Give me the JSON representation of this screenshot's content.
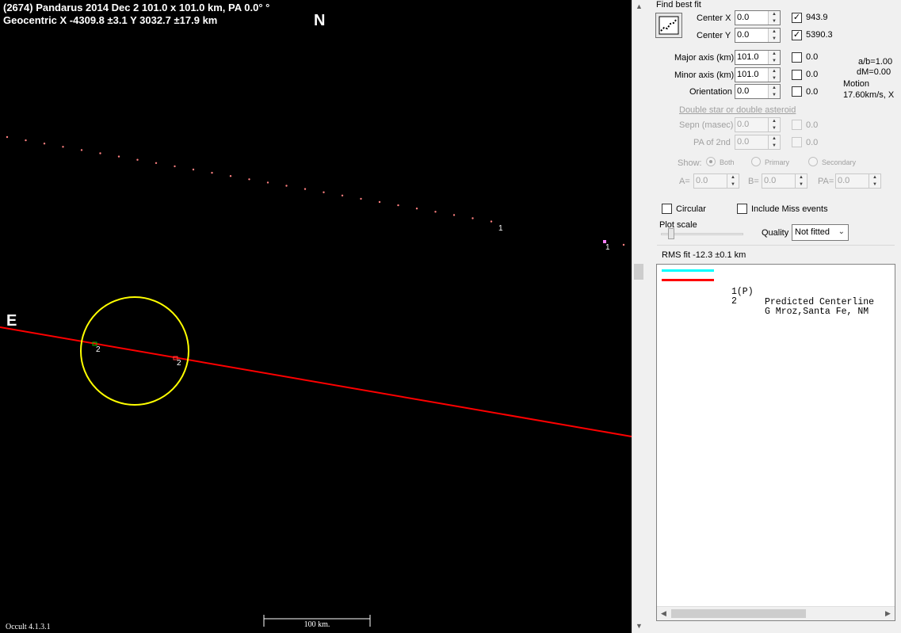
{
  "plot": {
    "title_line1": "(2674) Pandarus  2014 Dec 2  101.0 x 101.0 km, PA 0.0° °",
    "title_line2": "Geocentric  X  -4309.8 ±3.1  Y 3032.7 ±17.9 km",
    "north_label": "N",
    "east_label": "E",
    "version": "Occult 4.1.3.1",
    "scale_label": "100 km.",
    "markers": [
      {
        "label": "1"
      },
      {
        "label": "1"
      },
      {
        "label": "2"
      },
      {
        "label": "2"
      }
    ],
    "colors": {
      "background": "#000000",
      "ellipse": "#ffff00",
      "chord": "#ff0000",
      "predicted": "#00ffff",
      "dots": "#ff8080"
    }
  },
  "panel": {
    "find_best_fit": "Find best fit",
    "center_x": {
      "label": "Center X",
      "value": "0.0",
      "fit_value": "943.9",
      "checked": true
    },
    "center_y": {
      "label": "Center Y",
      "value": "0.0",
      "fit_value": "5390.3",
      "checked": true
    },
    "major_axis": {
      "label": "Major axis (km)",
      "value": "101.0",
      "fit_value": "0.0",
      "checked": false
    },
    "minor_axis": {
      "label": "Minor axis (km)",
      "value": "101.0",
      "fit_value": "0.0",
      "checked": false
    },
    "orientation": {
      "label": "Orientation",
      "value": "0.0",
      "fit_value": "0.0",
      "checked": false
    },
    "ab_ratio": "a/b=1.00",
    "dm": "dM=0.00",
    "motion_label": "Motion",
    "motion_value": "17.60km/s, X",
    "double_star_link": "Double star  or  double asteroid",
    "sepn": {
      "label": "Sepn (masec)",
      "value": "0.0",
      "fit_value": "0.0"
    },
    "pa_2nd": {
      "label": "PA of 2nd",
      "value": "0.0",
      "fit_value": "0.0"
    },
    "show_label": "Show:",
    "show_options": [
      "Both",
      "Primary",
      "Secondary"
    ],
    "a_field": {
      "label": "A=",
      "value": "0.0"
    },
    "b_field": {
      "label": "B=",
      "value": "0.0"
    },
    "pa_field": {
      "label": "PA=",
      "value": "0.0"
    },
    "circular_label": "Circular",
    "include_miss_label": "Include Miss events",
    "plot_scale_label": "Plot scale",
    "quality_label": "Quality",
    "quality_value": "Not fitted",
    "rms_fit": "RMS fit -12.3 ±0.1 km",
    "legend": [
      {
        "num": "1(P)",
        "name": "Predicted Centerline",
        "color": "#00ffff"
      },
      {
        "num": "2",
        "name": "G Mroz,Santa Fe, NM",
        "color": "#ff0000"
      }
    ]
  }
}
